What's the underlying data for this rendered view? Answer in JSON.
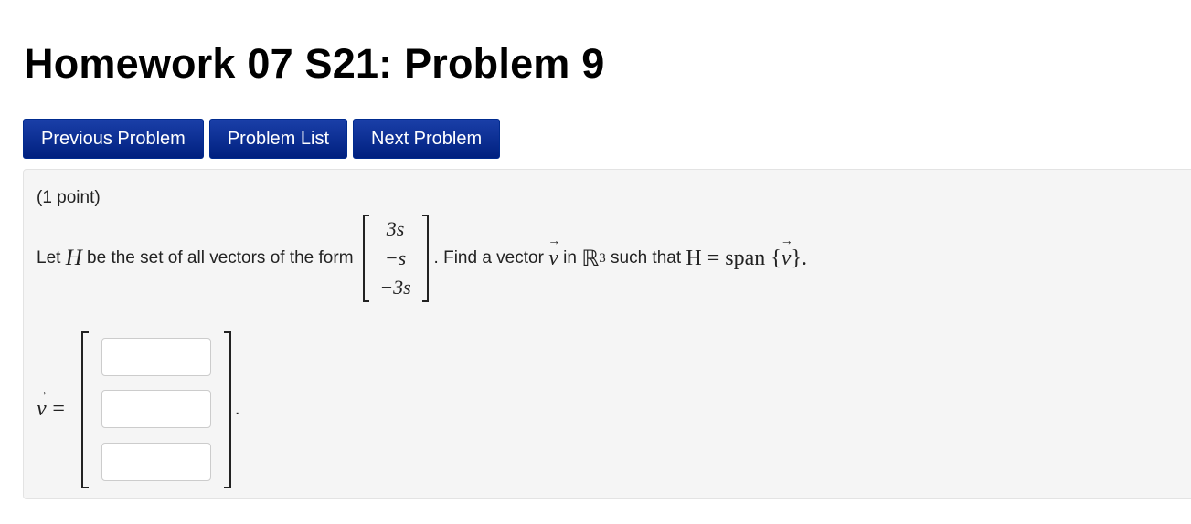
{
  "page": {
    "title": "Homework 07 S21: Problem 9"
  },
  "nav": {
    "previous": "Previous Problem",
    "list": "Problem List",
    "next": "Next Problem"
  },
  "problem": {
    "points": "(1 point)",
    "text_let": "Let",
    "var_H": "H",
    "text_form": "be the set of all vectors of the form",
    "matrix": [
      "3s",
      "−s",
      "−3s"
    ],
    "text_find": ". Find a vector",
    "var_v": "v",
    "text_in": "in",
    "space_R": "ℝ",
    "space_exp": "3",
    "text_such": "such that",
    "eq": "H = span {",
    "eq_end": "}.",
    "answer_label": "=",
    "answer_period": ".",
    "answer_values": [
      "",
      "",
      ""
    ]
  }
}
